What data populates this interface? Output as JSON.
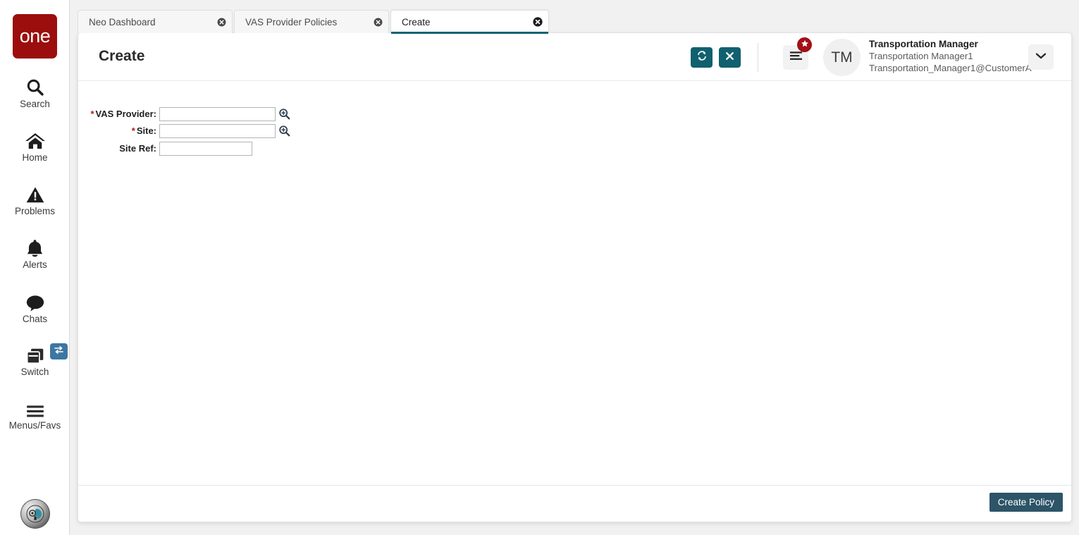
{
  "app": {
    "logo_text": "one",
    "logo_color": "#9c0d0d"
  },
  "sidebar": {
    "items": [
      {
        "label": "Search",
        "icon": "search-icon"
      },
      {
        "label": "Home",
        "icon": "home-icon"
      },
      {
        "label": "Problems",
        "icon": "warning-triangle-icon"
      },
      {
        "label": "Alerts",
        "icon": "bell-icon"
      },
      {
        "label": "Chats",
        "icon": "chat-bubble-icon"
      },
      {
        "label": "Switch",
        "icon": "windows-stack-icon"
      },
      {
        "label": "Menus/Favs",
        "icon": "hamburger-icon"
      }
    ],
    "switch_badge_icon": "swap-arrows-icon",
    "switch_badge_color": "#3d76a3",
    "assistant_icon": "assistant-orb-icon"
  },
  "tabs": [
    {
      "label": "Neo Dashboard",
      "active": false
    },
    {
      "label": "VAS Provider Policies",
      "active": false
    },
    {
      "label": "Create",
      "active": true
    }
  ],
  "tab_active_underline_color": "#0f6272",
  "header": {
    "title": "Create",
    "refresh_icon": "refresh-icon",
    "close_icon": "close-x-icon",
    "action_button_color": "#11606f",
    "menu_icon": "list-menu-icon",
    "badge_icon": "star-icon",
    "badge_color": "#a30f16",
    "avatar_initials": "TM",
    "user_role": "Transportation Manager",
    "user_name": "Transportation Manager1",
    "user_email": "Transportation_Manager1@CustomerA",
    "dropdown_icon": "chevron-down-icon"
  },
  "form": {
    "fields": [
      {
        "label": "VAS Provider:",
        "required": true,
        "value": "",
        "placeholder": "",
        "lookup": true,
        "width": "wide"
      },
      {
        "label": "Site:",
        "required": true,
        "value": "",
        "placeholder": "",
        "lookup": true,
        "width": "wide"
      },
      {
        "label": "Site Ref:",
        "required": false,
        "value": "",
        "placeholder": "",
        "lookup": false,
        "width": "narrow"
      }
    ],
    "lookup_icon": "magnifier-zoom-in-icon"
  },
  "footer": {
    "create_policy_label": "Create Policy",
    "create_policy_color": "#2d5467"
  }
}
